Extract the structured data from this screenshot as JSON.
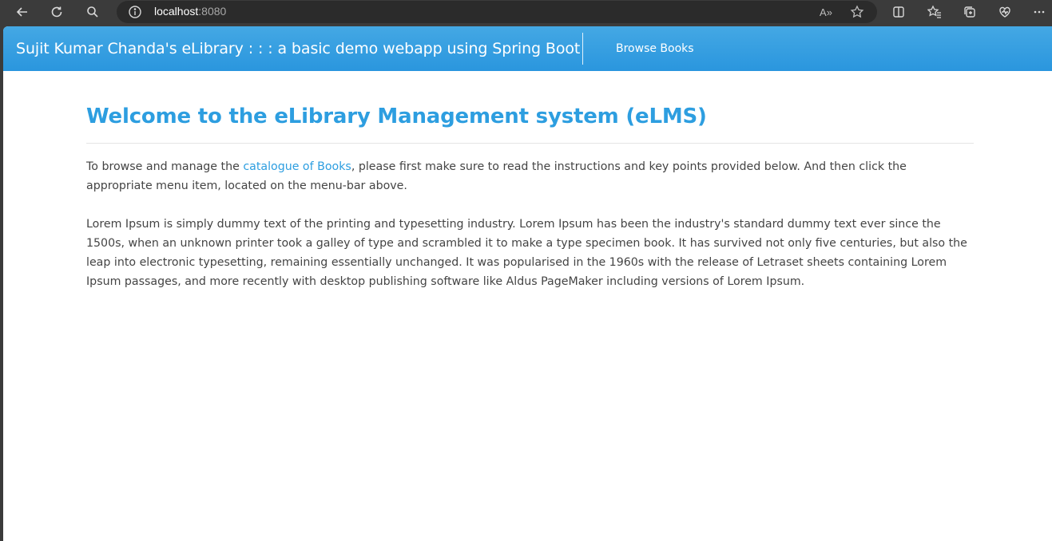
{
  "browser": {
    "url_host": "localhost",
    "url_port": ":8080",
    "read_aloud_label": "A»",
    "icons": [
      "back-icon",
      "refresh-icon",
      "search-icon",
      "site-info-icon",
      "read-aloud-icon",
      "favorite-star-icon",
      "split-screen-icon",
      "favorites-icon",
      "collections-icon",
      "browser-essentials-icon",
      "more-icon"
    ]
  },
  "navbar": {
    "brand": "Sujit Kumar Chanda's eLibrary : : : a basic demo webapp using Spring Boot",
    "links": [
      {
        "label": "Browse Books"
      }
    ]
  },
  "main": {
    "title": "Welcome to the eLibrary Management system (eLMS)",
    "intro_before": "To browse and manage the ",
    "intro_link": "catalogue of Books",
    "intro_after": ", please first make sure to read the instructions and key points provided below. And then click the appropriate menu item, located on the menu-bar above.",
    "lorem": "Lorem Ipsum is simply dummy text of the printing and typesetting industry. Lorem Ipsum has been the industry's standard dummy text ever since the 1500s, when an unknown printer took a galley of type and scrambled it to make a type specimen book. It has survived not only five centuries, but also the leap into electronic typesetting, remaining essentially unchanged. It was popularised in the 1960s with the release of Letraset sheets containing Lorem Ipsum passages, and more recently with desktop publishing software like Aldus PageMaker including versions of Lorem Ipsum."
  },
  "colors": {
    "navbar": "#2a96de",
    "accent": "#2d9ee0",
    "body_text": "#444444"
  }
}
